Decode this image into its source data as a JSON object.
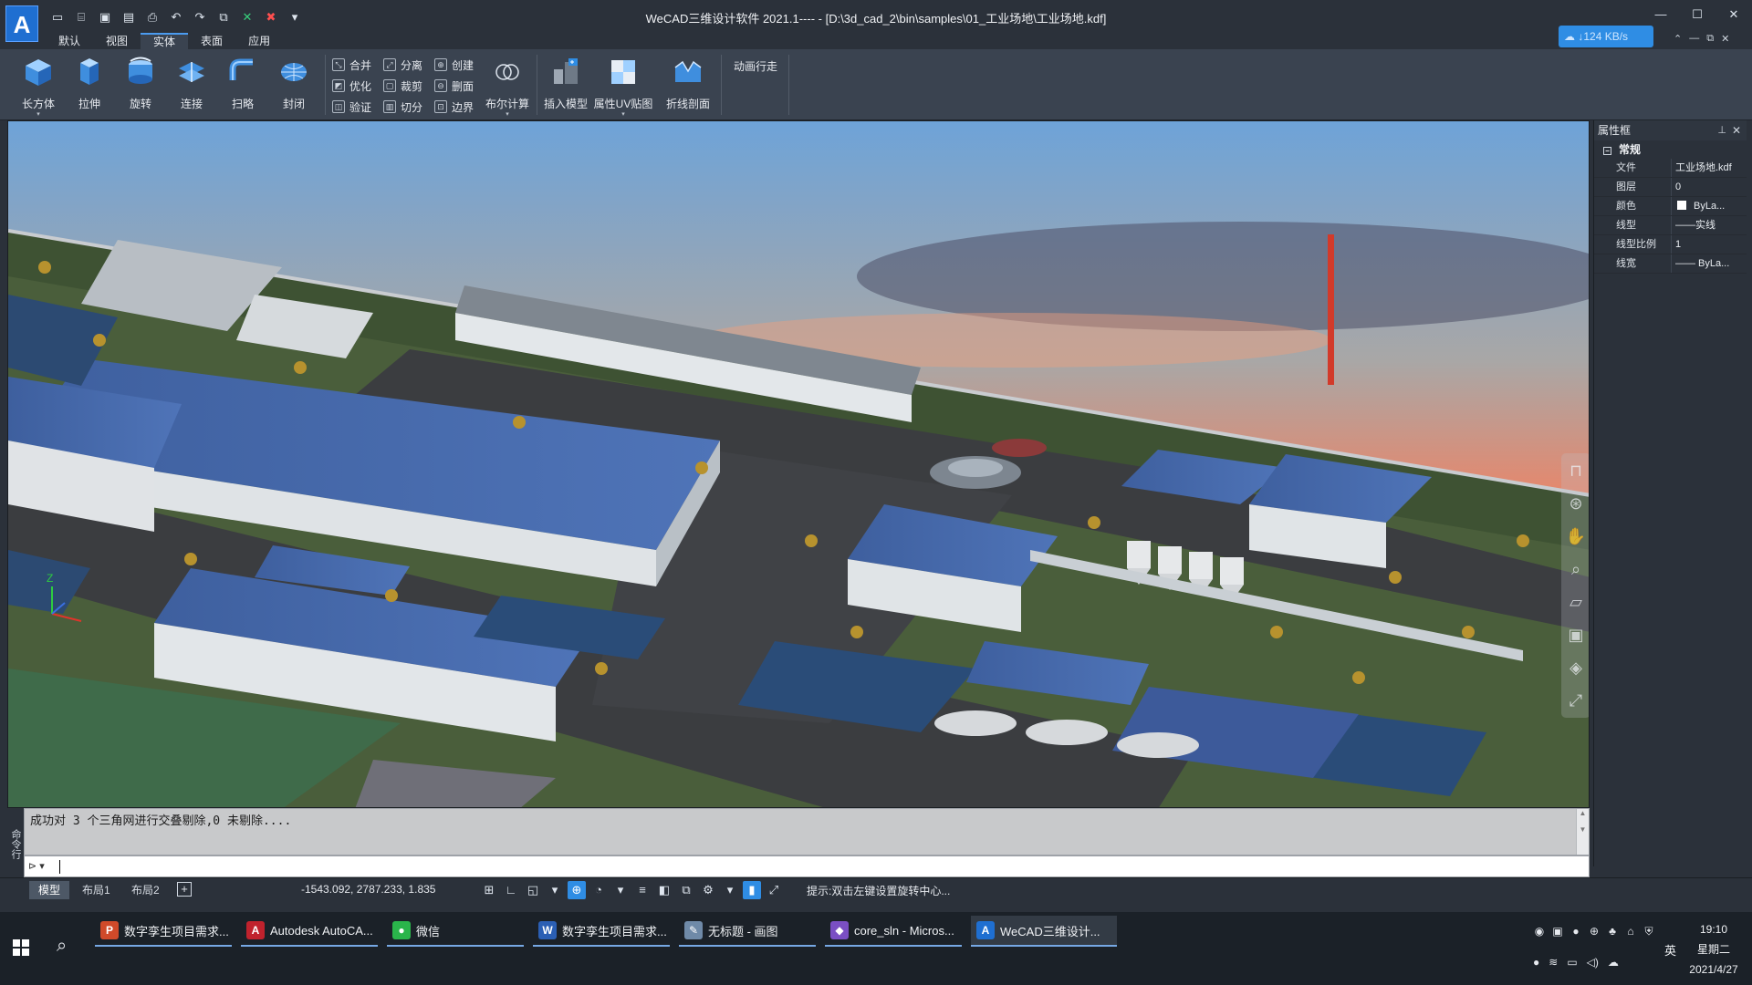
{
  "window": {
    "title": "WeCAD三维设计软件 2021.1---- - [D:\\3d_cad_2\\bin\\samples\\01_工业场地\\工业场地.kdf]",
    "logo": "A",
    "net_speed": "↓124 KB/s"
  },
  "quick_access": [
    "new-file-icon",
    "open-icon",
    "save-icon",
    "save-as-icon",
    "print-icon",
    "undo-icon",
    "redo-icon",
    "copy-window-icon",
    "close-green-icon",
    "close-red-icon",
    "dropdown-icon"
  ],
  "tabs": [
    {
      "label": "默认",
      "active": false
    },
    {
      "label": "视图",
      "active": false
    },
    {
      "label": "实体",
      "active": true
    },
    {
      "label": "表面",
      "active": false
    },
    {
      "label": "应用",
      "active": false
    }
  ],
  "ribbon": {
    "solids": [
      "长方体",
      "拉伸",
      "旋转",
      "连接",
      "扫略",
      "封闭"
    ],
    "ops_col1": [
      "合并",
      "优化",
      "验证"
    ],
    "ops_col2": [
      "分离",
      "裁剪",
      "切分"
    ],
    "ops_col3": [
      "创建",
      "删面",
      "边界"
    ],
    "boolean": "布尔计算",
    "insert_model": "插入模型",
    "uv_map": "属性UV贴图",
    "fold_section": "折线剖面",
    "animation_walk": "动画行走"
  },
  "properties": {
    "header": "属性框",
    "group": "常规",
    "rows": [
      {
        "key": "文件",
        "value": "工业场地.kdf"
      },
      {
        "key": "图层",
        "value": "0"
      },
      {
        "key": "颜色",
        "value": "ByLa..."
      },
      {
        "key": "线型",
        "value": "——实线"
      },
      {
        "key": "线型比例",
        "value": "1"
      },
      {
        "key": "线宽",
        "value": "—— ByLa..."
      }
    ]
  },
  "command": {
    "side_label": "命令行",
    "history": "成功对 3 个三角网进行交叠剔除,0 未剔除....",
    "prompt": "⊳ ▾"
  },
  "status": {
    "layouts": [
      {
        "label": "模型",
        "active": true
      },
      {
        "label": "布局1",
        "active": false
      },
      {
        "label": "布局2",
        "active": false
      }
    ],
    "add": "+",
    "coordinates": "-1543.092, 2787.233, 1.835",
    "hint": "提示:双击左键设置旋转中心..."
  },
  "taskbar": {
    "apps": [
      {
        "label": "数字孪生项目需求...",
        "icon": "P",
        "color": "#d04a2a",
        "active": false
      },
      {
        "label": "Autodesk AutoCA...",
        "icon": "A",
        "color": "#c0222d",
        "active": false
      },
      {
        "label": "微信",
        "icon": "●",
        "color": "#2ab54b",
        "active": false
      },
      {
        "label": "数字孪生项目需求...",
        "icon": "W",
        "color": "#2b5fb4",
        "active": false
      },
      {
        "label": "无标题 - 画图",
        "icon": "✎",
        "color": "#6f8aa8",
        "active": false
      },
      {
        "label": "core_sln - Micros...",
        "icon": "◆",
        "color": "#7a4fc4",
        "active": false
      },
      {
        "label": "WeCAD三维设计...",
        "icon": "A",
        "color": "#1f6fd1",
        "active": true
      }
    ],
    "ime": "英",
    "time": "19:10",
    "weekday": "星期二",
    "date": "2021/4/27"
  },
  "viewport": {
    "axis_z": "Z"
  }
}
